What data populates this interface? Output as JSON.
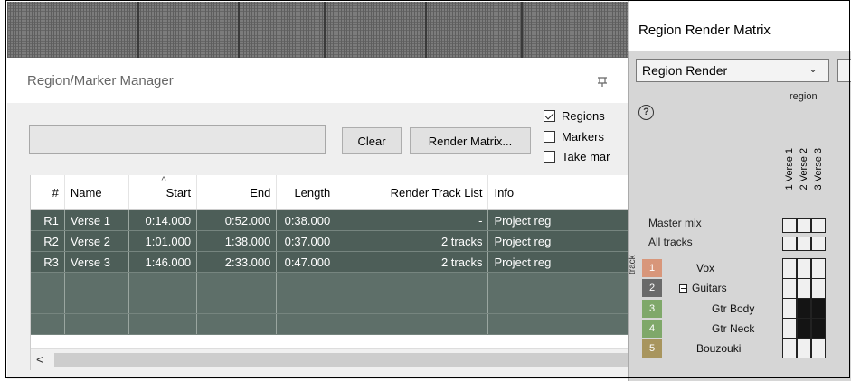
{
  "manager": {
    "title": "Region/Marker Manager",
    "search_value": "",
    "clear_label": "Clear",
    "render_matrix_label": "Render Matrix...",
    "checkboxes": [
      {
        "label": "Regions",
        "checked": true
      },
      {
        "label": "Markers",
        "checked": false
      },
      {
        "label": "Take mar",
        "checked": false
      }
    ],
    "columns": [
      "#",
      "Name",
      "Start",
      "End",
      "Length",
      "Render Track List",
      "Info"
    ],
    "rows": [
      {
        "id": "R1",
        "name": "Verse 1",
        "start": "0:14.000",
        "end": "0:52.000",
        "length": "0:38.000",
        "render": "-",
        "info": "Project reg"
      },
      {
        "id": "R2",
        "name": "Verse 2",
        "start": "1:01.000",
        "end": "1:38.000",
        "length": "0:37.000",
        "render": "2 tracks",
        "info": "Project reg"
      },
      {
        "id": "R3",
        "name": "Verse 3",
        "start": "1:46.000",
        "end": "2:33.000",
        "length": "0:47.000",
        "render": "2 tracks",
        "info": "Project reg"
      }
    ],
    "scroll_left_glyph": "<"
  },
  "matrix": {
    "title": "Region Render Matrix",
    "dropdown_value": "Region Render",
    "help_glyph": "?",
    "region_label": "region",
    "track_label": "track",
    "columns": [
      "1  Verse 1",
      "2  Verse 2",
      "3  Verse 3"
    ],
    "master_label": "Master mix",
    "all_tracks_label": "All tracks",
    "tracks": [
      {
        "num": "1",
        "name": "Vox",
        "color": "#d8967a",
        "cells": [
          false,
          false,
          false
        ]
      },
      {
        "num": "2",
        "name": "Guitars",
        "color": "#6a6a6a",
        "cells": [
          false,
          false,
          false
        ]
      },
      {
        "num": "3",
        "name": "Gtr Body",
        "color": "#7fa86a",
        "cells": [
          false,
          true,
          true
        ]
      },
      {
        "num": "4",
        "name": "Gtr Neck",
        "color": "#7fa86a",
        "cells": [
          false,
          true,
          true
        ]
      },
      {
        "num": "5",
        "name": "Bouzouki",
        "color": "#a8955e",
        "cells": [
          false,
          false,
          false
        ]
      }
    ]
  }
}
